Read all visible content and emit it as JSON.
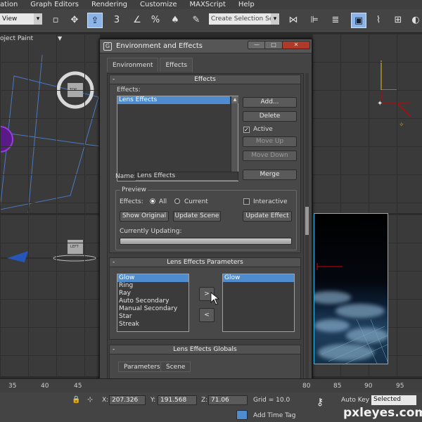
{
  "menu": [
    "ation",
    "Graph Editors",
    "Rendering",
    "Customize",
    "MAXScript",
    "Help"
  ],
  "toolbar": {
    "view_select": "View",
    "selection_set_placeholder": "Create Selection Se"
  },
  "viewport": {
    "label": "oject Paint"
  },
  "viewcube_labels": {
    "top": "TOP",
    "left": "LEFT"
  },
  "dialog": {
    "title": "Environment and Effects",
    "win_buttons": {
      "minimize": "—",
      "maximize": "□",
      "close": "✕"
    },
    "tabs": [
      {
        "label": "Environment"
      },
      {
        "label": "Effects"
      }
    ],
    "effects_rollout": {
      "title": "Effects",
      "collapse_symbol": "-",
      "effects_label": "Effects:",
      "list": [
        "Lens Effects"
      ],
      "buttons": {
        "add": "Add...",
        "delete": "Delete",
        "move_up": "Move Up",
        "move_down": "Move Down",
        "merge": "Merge"
      },
      "active_label": "Active",
      "active_checked": true,
      "name_label": "Name:",
      "name_value": "Lens Effects",
      "preview": {
        "title": "Preview",
        "effects_label": "Effects:",
        "all_label": "All",
        "current_label": "Current",
        "selected": "All",
        "interactive_label": "Interactive",
        "interactive_checked": false,
        "show_original": "Show Original",
        "update_scene": "Update Scene",
        "update_effect": "Update Effect",
        "currently_updating_label": "Currently Updating:",
        "progress_fraction": 0
      }
    },
    "lens_params_rollout": {
      "title": "Lens Effects Parameters",
      "collapse_symbol": "-",
      "available": [
        "Glow",
        "Ring",
        "Ray",
        "Auto Secondary",
        "Manual Secondary",
        "Star",
        "Streak"
      ],
      "available_selected": 0,
      "active": [
        "Glow"
      ],
      "active_selected": 0,
      "add_button": ">",
      "remove_button": "<"
    },
    "globals_rollout": {
      "title": "Lens Effects Globals",
      "collapse_symbol": "-",
      "tabs": [
        {
          "label": "Parameters"
        },
        {
          "label": "Scene"
        }
      ]
    }
  },
  "timeline": {
    "ticks": [
      "35",
      "40",
      "45",
      "80",
      "85",
      "90",
      "95"
    ]
  },
  "status": {
    "x_label": "X:",
    "x_value": "207.326",
    "y_label": "Y:",
    "y_value": "191.568",
    "z_label": "Z:",
    "z_value": "71.06",
    "grid": "Grid = 10.0",
    "auto_key": "Auto Key",
    "selected": "Selected",
    "add_time_tag": "Add Time Tag"
  },
  "watermark": "pxleyes.com",
  "colors": {
    "selection_blue": "#4f8ccf",
    "render_frame_border": "#33ccff",
    "viewport_bg": "#3a3a3a"
  }
}
